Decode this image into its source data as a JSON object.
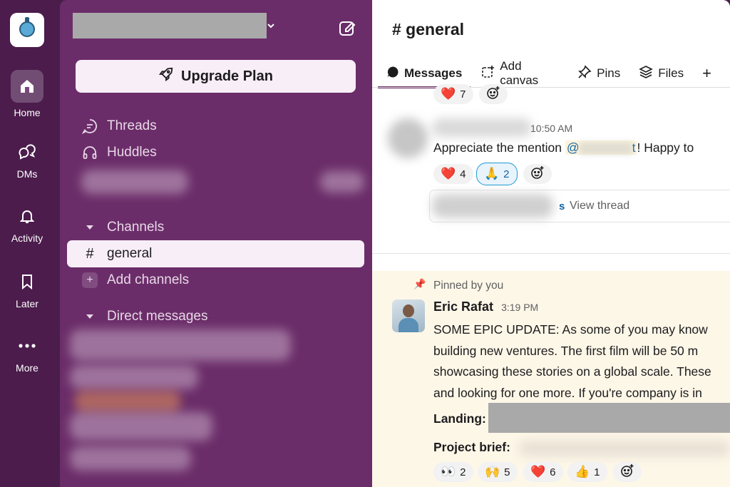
{
  "rail": {
    "items": [
      {
        "label": "Home"
      },
      {
        "label": "DMs"
      },
      {
        "label": "Activity"
      },
      {
        "label": "Later"
      },
      {
        "label": "More"
      }
    ]
  },
  "sidebar": {
    "upgrade_label": "Upgrade Plan",
    "threads": "Threads",
    "huddles": "Huddles",
    "channels_header": "Channels",
    "channel_general": "general",
    "add_channels": "Add channels",
    "dm_header": "Direct messages"
  },
  "channel": {
    "title": "# general",
    "tabs": [
      {
        "label": "Messages"
      },
      {
        "label": "Add canvas"
      },
      {
        "label": "Pins"
      },
      {
        "label": "Files"
      }
    ]
  },
  "messages": {
    "top_reaction": {
      "emoji": "❤️",
      "count": "7"
    },
    "msg1": {
      "time": "10:50 AM",
      "text_before": "Appreciate the mention ",
      "mention_prefix": "@",
      "mention_suffix": "t",
      "text_after": "!  Happy to",
      "reactions": [
        {
          "emoji": "❤️",
          "count": "4"
        },
        {
          "emoji": "🙏",
          "count": "2"
        }
      ],
      "view_thread_suffix": "s",
      "view_thread": "View thread"
    },
    "pinned": {
      "label": "Pinned by you",
      "author": "Eric Rafat",
      "time": "3:19 PM",
      "lines": [
        "SOME EPIC UPDATE: As some of you may know",
        "building new ventures. The first film will be 50 m",
        "showcasing these stories on a global scale. These",
        "and looking for one more. If you're company is in"
      ],
      "landing_label": "Landing:",
      "brief_label": "Project brief:",
      "reactions": [
        {
          "emoji": "👀",
          "count": "2"
        },
        {
          "emoji": "🙌",
          "count": "5"
        },
        {
          "emoji": "❤️",
          "count": "6"
        },
        {
          "emoji": "👍",
          "count": "1"
        }
      ]
    }
  },
  "colors": {
    "aubergine": "#4b1c4c",
    "sidebar": "#6b2d69",
    "mention_bg": "#fcf4dc",
    "pinned_bg": "#fdf7e8"
  }
}
